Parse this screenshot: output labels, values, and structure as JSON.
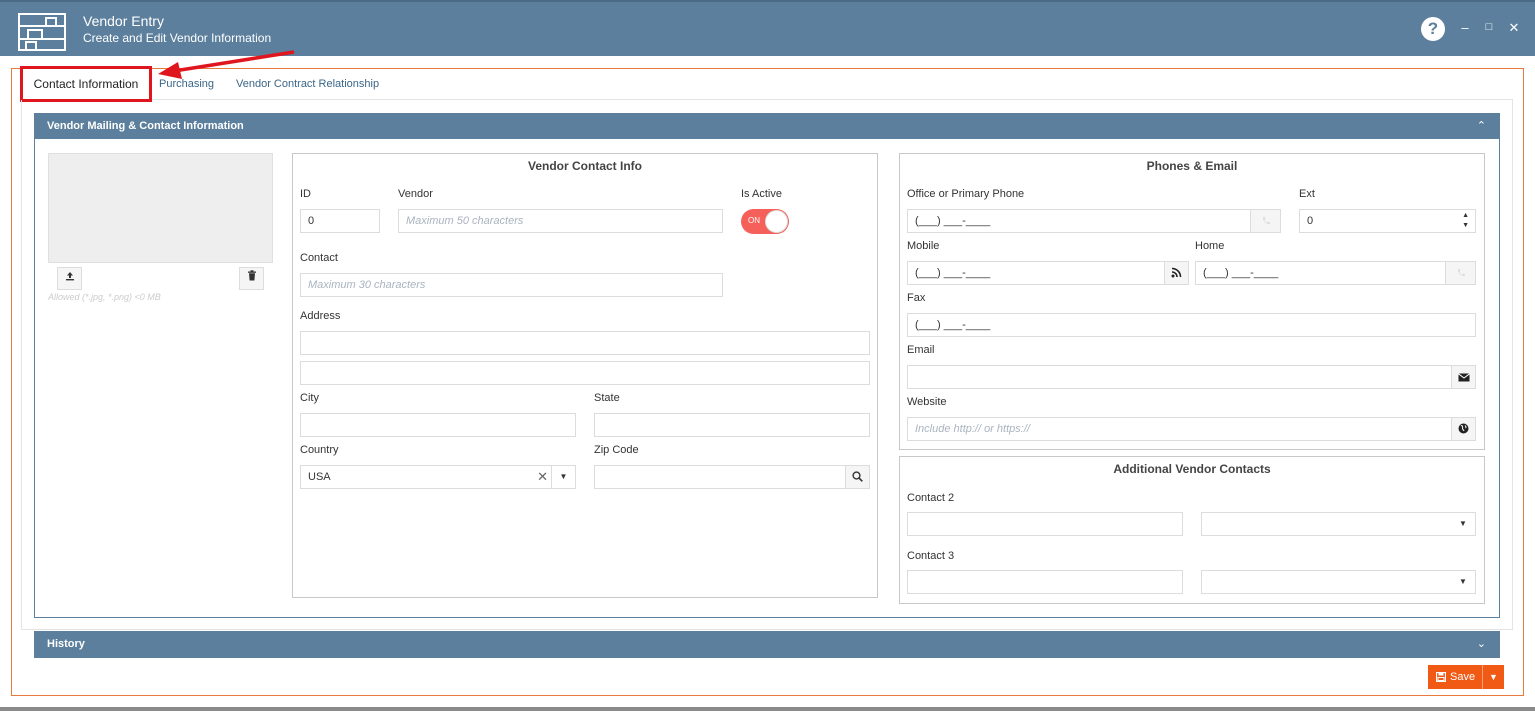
{
  "window": {
    "title": "Vendor Entry",
    "subtitle": "Create and Edit Vendor Information",
    "help_label": "?",
    "minimize_label": "‒",
    "maximize_label": "□",
    "close_label": "✕"
  },
  "tabs": [
    {
      "label": "Contact Information",
      "active": true
    },
    {
      "label": "Purchasing"
    },
    {
      "label": "Vendor Contract Relationship"
    }
  ],
  "panels": {
    "mailing_title": "Vendor Mailing & Contact Information",
    "history_title": "History"
  },
  "image": {
    "allowed_text": "Allowed (*.jpg, *.png) <0 MB"
  },
  "contact_info": {
    "title": "Vendor Contact Info",
    "id_label": "ID",
    "id_value": "0",
    "vendor_label": "Vendor",
    "vendor_placeholder": "Maximum 50 characters",
    "is_active_label": "Is Active",
    "toggle_text": "ON",
    "contact_label": "Contact",
    "contact_placeholder": "Maximum 30 characters",
    "address_label": "Address",
    "city_label": "City",
    "state_label": "State",
    "country_label": "Country",
    "country_value": "USA",
    "zip_label": "Zip Code"
  },
  "phones": {
    "title": "Phones & Email",
    "office_label": "Office or Primary Phone",
    "office_mask": "(___) ___-____",
    "ext_label": "Ext",
    "ext_value": "0",
    "mobile_label": "Mobile",
    "mobile_mask": "(___) ___-____",
    "home_label": "Home",
    "home_mask": "(___) ___-____",
    "fax_label": "Fax",
    "fax_mask": "(___) ___-____",
    "email_label": "Email",
    "website_label": "Website",
    "website_placeholder": "Include http:// or https://"
  },
  "additional": {
    "title": "Additional Vendor Contacts",
    "contact2_label": "Contact 2",
    "contact3_label": "Contact 3"
  },
  "actions": {
    "save_label": "Save"
  },
  "colors": {
    "header": "#5b7f9c",
    "accent": "#f05a14",
    "highlight": "#e0161e"
  }
}
